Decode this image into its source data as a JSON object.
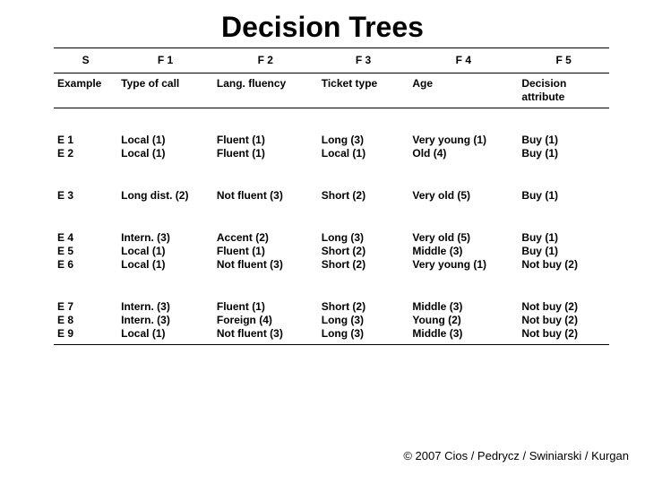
{
  "title": "Decision Trees",
  "hdr1": {
    "s": "S",
    "f1": "F 1",
    "f2": "F 2",
    "f3": "F 3",
    "f4": "F 4",
    "f5": "F 5"
  },
  "hdr2": {
    "s": "Example",
    "f1": "Type of call",
    "f2": "Lang. fluency",
    "f3": "Ticket type",
    "f4": "Age",
    "f5": "Decision attribute"
  },
  "grp1": {
    "s": {
      "l0": "E 1",
      "l1": "E 2"
    },
    "f1": {
      "l0": "Local (1)",
      "l1": "Local (1)"
    },
    "f2": {
      "l0": "Fluent (1)",
      "l1": "Fluent (1)"
    },
    "f3": {
      "l0": "Long (3)",
      "l1": "Local (1)"
    },
    "f4": {
      "l0": "Very young (1)",
      "l1": "Old (4)"
    },
    "f5": {
      "l0": "Buy (1)",
      "l1": "Buy (1)"
    }
  },
  "grp2": {
    "s": {
      "l0": "E 3"
    },
    "f1": {
      "l0": "Long dist. (2)"
    },
    "f2": {
      "l0": "Not fluent (3)"
    },
    "f3": {
      "l0": "Short (2)"
    },
    "f4": {
      "l0": "Very old (5)"
    },
    "f5": {
      "l0": "Buy (1)"
    }
  },
  "grp3": {
    "s": {
      "l0": "E 4",
      "l1": "E 5",
      "l2": "E 6"
    },
    "f1": {
      "l0": "Intern. (3)",
      "l1": "Local (1)",
      "l2": "Local (1)"
    },
    "f2": {
      "l0": "Accent (2)",
      "l1": "Fluent (1)",
      "l2": "Not fluent (3)"
    },
    "f3": {
      "l0": "Long (3)",
      "l1": "Short (2)",
      "l2": "Short (2)"
    },
    "f4": {
      "l0": "Very old (5)",
      "l1": "Middle (3)",
      "l2": "Very young (1)"
    },
    "f5": {
      "l0": "Buy (1)",
      "l1": "Buy (1)",
      "l2": "Not buy (2)"
    }
  },
  "grp4": {
    "s": {
      "l0": "E 7",
      "l1": "E 8",
      "l2": "E 9"
    },
    "f1": {
      "l0": "Intern. (3)",
      "l1": "Intern. (3)",
      "l2": "Local (1)"
    },
    "f2": {
      "l0": "Fluent (1)",
      "l1": "Foreign (4)",
      "l2": "Not fluent (3)"
    },
    "f3": {
      "l0": "Short (2)",
      "l1": "Long (3)",
      "l2": "Long (3)"
    },
    "f4": {
      "l0": "Middle (3)",
      "l1": "Young (2)",
      "l2": "Middle (3)"
    },
    "f5": {
      "l0": "Not buy (2)",
      "l1": "Not buy (2)",
      "l2": "Not buy (2)"
    }
  },
  "copyright": "© 2007 Cios / Pedrycz / Swiniarski / Kurgan"
}
